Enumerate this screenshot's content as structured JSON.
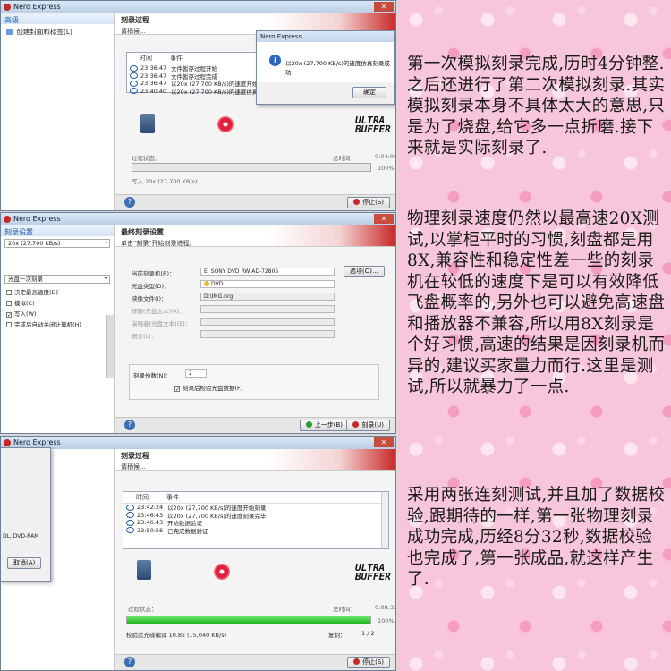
{
  "app": {
    "title": "Nero Express"
  },
  "win1": {
    "sidebar_head": "高级",
    "sidebar_item": "创建封面和标签(L)",
    "heading": "刻录过程",
    "subheading": "请稍候…",
    "log_header_time": "时间",
    "log_header_event": "事件",
    "log_rows": [
      {
        "time": "23:36:47",
        "event": "文件暂存过程开始"
      },
      {
        "time": "23:36:47",
        "event": "文件暂存过程完成"
      },
      {
        "time": "23:36:47",
        "event": "以20x (27,700 KB/s)的速度开始仿真刻录"
      },
      {
        "time": "23:40:40",
        "event": "以20x (27,700 KB/s)的速度仿真刻录完毕"
      }
    ],
    "status_label": "过程状态：",
    "total_time_label": "总时间：",
    "total_time": "0:04:00",
    "progress_pct": "100%",
    "progress": 0,
    "write_info": "写入 20x (27,700 KB/s)",
    "stop_button": "停止(S)",
    "dialog": {
      "title": "Nero Express",
      "message": "以20x (27,700 KB/s)的速度仿真刻录成功",
      "ok_button": "确定"
    }
  },
  "win2": {
    "sidebar_head": "刻录设置",
    "speed_select": "20x (27,700 KB/s)",
    "mode_select": "光盘一次刻录",
    "checks": [
      {
        "label": "决定最高速度(D)",
        "checked": ""
      },
      {
        "label": "模拟(C)",
        "checked": ""
      },
      {
        "label": "写入(W)",
        "checked": "✓"
      },
      {
        "label": "完成后自动关闭计算机(H)",
        "checked": ""
      }
    ],
    "heading": "最终刻录设置",
    "subheading": "单击\"刻录\"开始刻录进程。",
    "recorder_label": "当前刻录机(R)：",
    "recorder_value": "E: SONY DVD RW AD-7280S",
    "options_button": "选项(O)...",
    "disc_label": "光盘类型(D)：",
    "disc_value": "DVD",
    "image_label": "映像文件(I)：",
    "image_value": "D:\\IMG.nrg",
    "title_label": "标题(光盘文本)(X)：",
    "artist_label": "演唱者(光盘文本)(E)：",
    "lang_label": "语言(L)：",
    "copies_label": "刻录份数(N)：",
    "copies_value": "2",
    "verify_label": "刻录后检验光盘数据(F)",
    "verify_checked": "✓",
    "back_button": "上一步(B)",
    "burn_button": "刻录(U)"
  },
  "win3": {
    "dialog_fragment": "DL, DVD-RAM",
    "cancel_button": "取消(A)",
    "heading": "刻录过程",
    "subheading": "请稍候…",
    "log_header_time": "时间",
    "log_header_event": "事件",
    "log_rows": [
      {
        "time": "23:42:24",
        "event": "以20x (27,700 KB/s)的速度开始刻录"
      },
      {
        "time": "23:46:43",
        "event": "以20x (27,700 KB/s)的速度刻录完毕"
      },
      {
        "time": "23:46:43",
        "event": "开始数据验证"
      },
      {
        "time": "23:50:56",
        "event": "已完成数据验证"
      }
    ],
    "status_label": "过程状态：",
    "total_time_label": "总时间：",
    "total_time": "0:08:32",
    "progress_pct": "100%",
    "progress": 1,
    "verify_info": "校验此光碟编译 10.8x (15,040 KB/s)",
    "copy_label": "复制：",
    "copy_value": "1 / 2",
    "stop_button": "停止(S)"
  },
  "text": {
    "p1": "第一次模拟刻录完成,历时4分钟整.之后还进行了第二次模拟刻录.其实模拟刻录本身不具体太大的意思,只是为了烧盘,给它多一点折磨.接下来就是实际刻录了.",
    "p2": "物理刻录速度仍然以最高速20X测试,以掌柜平时的习惯,刻盘都是用8X,兼容性和稳定性差一些的刻录机在较低的速度下是可以有效降低飞盘概率的,另外也可以避免高速盘和播放器不兼容,所以用8X刻录是个好习惯,高速的结果是因刻录机而异的,建议买家量力而行.这里是测试,所以就暴力了一点.",
    "p3": "采用两张连刻测试,并且加了数据校验,跟期待的一样,第一张物理刻录成功完成,历经8分32秒,数据校验也完成了,第一张成品,就这样产生了."
  },
  "colors": {
    "accent": "#c62828",
    "progress": "#1fb41f",
    "panel_bg": "#f7c6db"
  }
}
